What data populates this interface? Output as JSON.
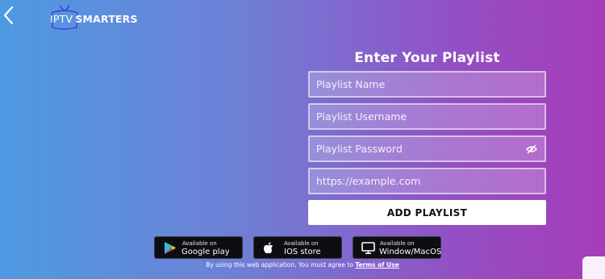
{
  "header": {
    "logo_text_part1": "IPTV",
    "logo_text_part2": "SMARTERS"
  },
  "form": {
    "title": "Enter Your Playlist",
    "name_placeholder": "Playlist Name",
    "username_placeholder": "Playlist Username",
    "password_placeholder": "Playlist Password",
    "url_placeholder": "https://example.com",
    "submit_label": "ADD PLAYLIST"
  },
  "stores": [
    {
      "small": "Available on",
      "big": "Google play",
      "icon": "google-play-icon"
    },
    {
      "small": "Available on",
      "big": "IOS store",
      "icon": "apple-icon"
    },
    {
      "small": "Available on",
      "big": "Window/MacOS",
      "icon": "monitor-icon"
    }
  ],
  "footer": {
    "terms_prefix": "By using this web application, You must agree to",
    "terms_link": "Terms of Use"
  },
  "colors": {
    "gradient_start": "#4e9ae2",
    "gradient_end": "#a63cb8",
    "button_bg": "#ffffff",
    "store_bg": "#0d0d12"
  }
}
